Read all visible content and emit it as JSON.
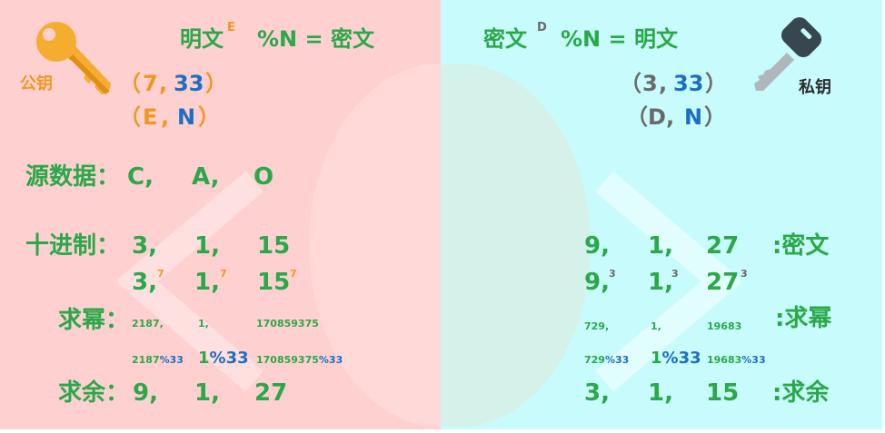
{
  "colors": {
    "green": "#2aa84a",
    "orange": "#f0981e",
    "blue": "#1d6fc0",
    "gray": "#6a6a6a",
    "left_bg": "#ffd0d0",
    "right_bg": "#c8fbfb"
  },
  "icons": {
    "public_key": "key-icon",
    "private_key": "key-icon"
  },
  "left": {
    "key_label": "公钥",
    "formula": {
      "base": "明文",
      "exp": "E",
      "rest": "%N = 密文"
    },
    "pair1": {
      "open": "（",
      "a": "7",
      "sep": ",",
      "b": "33",
      "close": "）"
    },
    "pair2": {
      "open": "（",
      "a": "E",
      "sep": ",",
      "b": "N",
      "close": "）"
    },
    "source_label": "源数据：",
    "source": [
      "C,",
      "A,",
      "O"
    ],
    "decimal_label": "十进制：",
    "decimal": [
      "3,",
      "1,",
      "15"
    ],
    "power": [
      {
        "base": "3,",
        "exp": "7"
      },
      {
        "base": "1,",
        "exp": "7"
      },
      {
        "base": "15",
        "exp": "7"
      }
    ],
    "pow_label": "求幂：",
    "pow_values": [
      "2187,",
      "1,",
      "170859375"
    ],
    "mod": [
      {
        "a": "2187",
        "b": "%33"
      },
      {
        "a": "1",
        "b": "%33"
      },
      {
        "a": "170859375",
        "b": "%33"
      }
    ],
    "rem_label": "求余：",
    "rem_values": [
      "9,",
      "1,",
      "27"
    ]
  },
  "right": {
    "key_label": "私钥",
    "formula": {
      "base": "密文",
      "exp": "D",
      "rest": "%N = 明文"
    },
    "pair1": {
      "open": "（",
      "a": "3",
      "sep": ",",
      "b": "33",
      "close": "）"
    },
    "pair2": {
      "open": "（",
      "a": "D",
      "sep": ",",
      "b": "N",
      "close": "）"
    },
    "cipher_values": [
      "9,",
      "1,",
      "27"
    ],
    "cipher_label": ":密文",
    "power": [
      {
        "base": "9,",
        "exp": "3"
      },
      {
        "base": "1,",
        "exp": "3"
      },
      {
        "base": "27",
        "exp": "3"
      }
    ],
    "pow_values": [
      "729,",
      "1,",
      "19683"
    ],
    "pow_label": ":求幂",
    "mod": [
      {
        "a": "729",
        "b": "%33"
      },
      {
        "a": "1",
        "b": "%33"
      },
      {
        "a": "19683",
        "b": "%33"
      }
    ],
    "rem_values": [
      "3,",
      "1,",
      "15"
    ],
    "rem_label": ":求余"
  }
}
